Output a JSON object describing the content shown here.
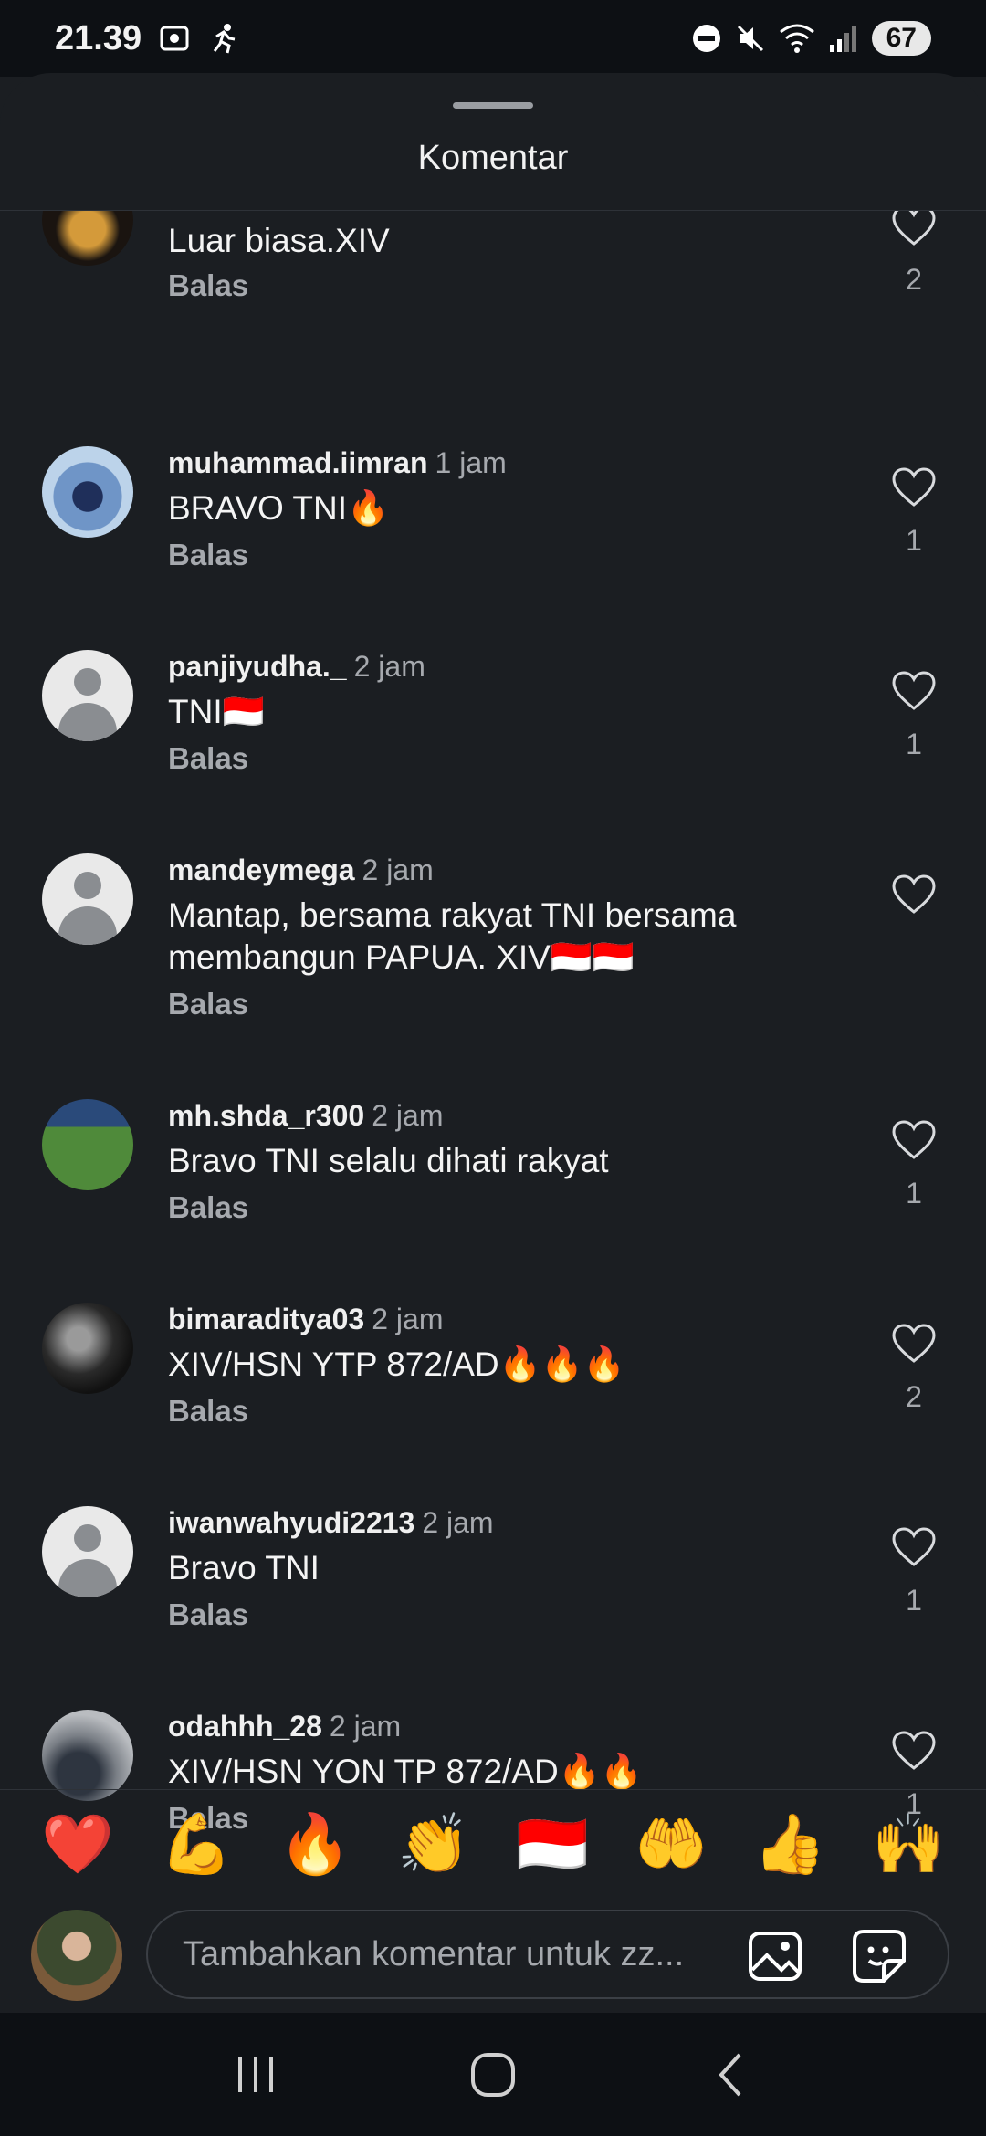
{
  "status_bar": {
    "time": "21.39",
    "battery": "67",
    "icons": [
      "screen-record-icon",
      "activity-icon",
      "do-not-disturb-icon",
      "mute-icon",
      "wifi-icon",
      "signal-icon"
    ]
  },
  "sheet": {
    "title": "Komentar"
  },
  "comments": [
    {
      "username": "",
      "time": "",
      "text": "Luar biasa.XIV",
      "reply": "Balas",
      "likes": "2"
    },
    {
      "username": "muhammad.iimran",
      "time": "1 jam",
      "text": "BRAVO TNI🔥",
      "reply": "Balas",
      "likes": "1"
    },
    {
      "username": "panjiyudha._",
      "time": "2 jam",
      "text": "TNI🇮🇩",
      "reply": "Balas",
      "likes": "1"
    },
    {
      "username": "mandeymega",
      "time": "2 jam",
      "text": "Mantap, bersama rakyat TNI bersama membangun PAPUA. XIV🇮🇩🇮🇩",
      "reply": "Balas",
      "likes": ""
    },
    {
      "username": "mh.shda_r300",
      "time": "2 jam",
      "text": "Bravo TNI selalu dihati rakyat",
      "reply": "Balas",
      "likes": "1"
    },
    {
      "username": "bimaraditya03",
      "time": "2 jam",
      "text": "XIV/HSN YTP 872/AD🔥🔥🔥",
      "reply": "Balas",
      "likes": "2"
    },
    {
      "username": "iwanwahyudi2213",
      "time": "2 jam",
      "text": "Bravo TNI",
      "reply": "Balas",
      "likes": "1"
    },
    {
      "username": "odahhh_28",
      "time": "2 jam",
      "text": "XIV/HSN YON TP 872/AD🔥🔥",
      "reply": "Balas",
      "likes": "1"
    }
  ],
  "emoji_bar": [
    "❤️",
    "💪",
    "🔥",
    "👏",
    "🇮🇩",
    "🤲",
    "👍",
    "🙌"
  ],
  "input": {
    "placeholder": "Tambahkan komentar untuk zz..."
  }
}
